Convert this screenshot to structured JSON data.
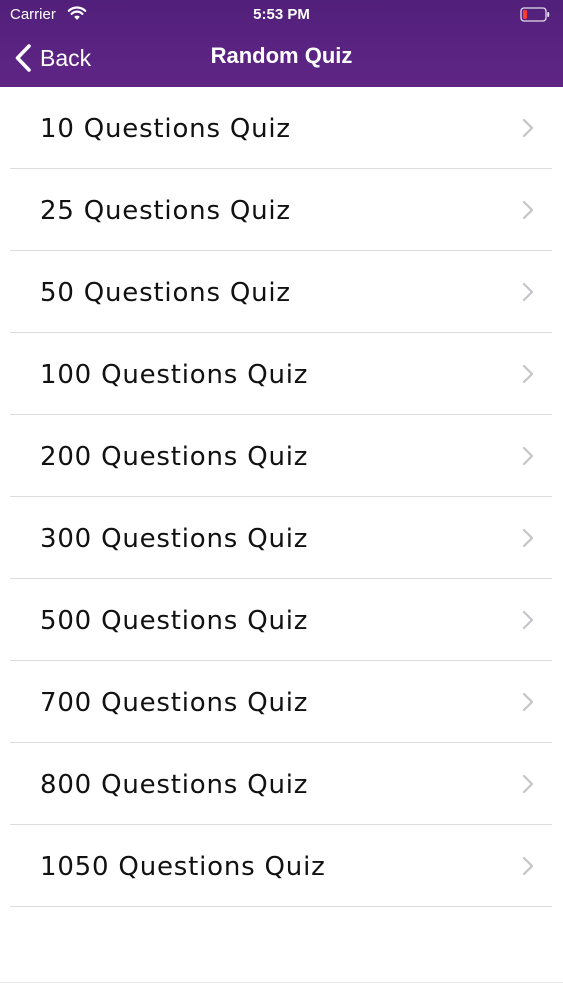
{
  "status_bar": {
    "carrier": "Carrier",
    "time": "5:53 PM",
    "battery_color": "#ff3b30"
  },
  "nav": {
    "back_label": "Back",
    "title": "Random Quiz",
    "bar_color": "#5a2382"
  },
  "quiz_options": [
    {
      "label": "10 Questions Quiz"
    },
    {
      "label": "25 Questions Quiz"
    },
    {
      "label": "50 Questions Quiz"
    },
    {
      "label": "100 Questions Quiz"
    },
    {
      "label": "200 Questions Quiz"
    },
    {
      "label": "300 Questions Quiz"
    },
    {
      "label": "500 Questions Quiz"
    },
    {
      "label": "700 Questions Quiz"
    },
    {
      "label": "800 Questions Quiz"
    },
    {
      "label": "1050 Questions Quiz"
    }
  ],
  "icons": {
    "back": "chevron-left-icon",
    "row": "chevron-right-icon",
    "wifi": "wifi-icon",
    "battery": "battery-icon"
  }
}
